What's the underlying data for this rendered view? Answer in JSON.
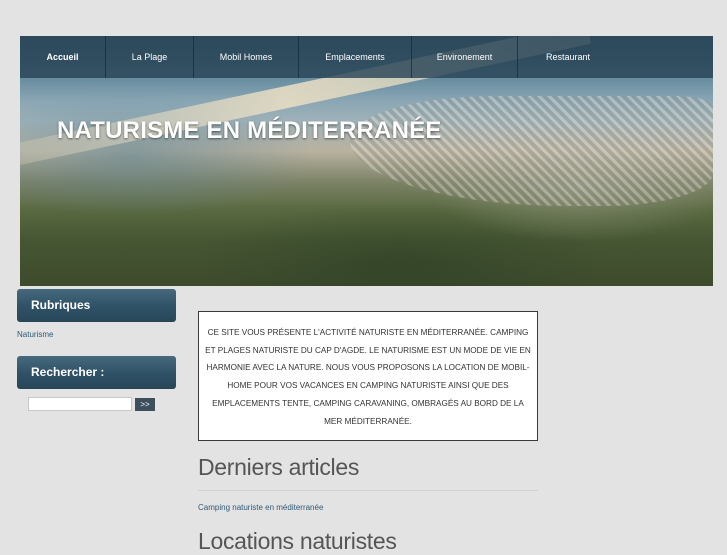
{
  "nav": {
    "items": [
      {
        "label": "Accueil",
        "active": true
      },
      {
        "label": "La Plage",
        "active": false
      },
      {
        "label": "Mobil Homes",
        "active": false
      },
      {
        "label": "Emplacements",
        "active": false
      },
      {
        "label": "Environement",
        "active": false
      },
      {
        "label": "Restaurant",
        "active": false
      }
    ]
  },
  "header": {
    "title": "NATURISME EN MÉDITERRANÉE"
  },
  "sidebar": {
    "rubriques_heading": "Rubriques",
    "rubriques_items": [
      "Naturisme"
    ],
    "search_heading": "Rechercher :",
    "search_value": "",
    "search_button": ">>"
  },
  "main": {
    "intro_text": "CE SITE VOUS PRÉSENTE L'ACTIVITÉ NATURISTE EN MÉDITERRANÉE. CAMPING ET PLAGES NATURISTE DU CAP D'AGDE. LE NATURISME EST UN MODE DE VIE EN HARMONIE AVEC LA NATURE. NOUS VOUS PROPOSONS LA LOCATION DE MOBIL-HOME POUR VOS VACANCES EN CAMPING NATURISTE AINSI QUE DES EMPLACEMENTS TENTE, CAMPING CARAVANING, OMBRAGÉS AU BORD DE LA MER MÉDITERRANÉE.",
    "latest_heading": "Derniers articles",
    "latest_items": [
      "Camping naturiste en méditerranée"
    ],
    "rentals_heading": "Locations naturistes"
  },
  "colors": {
    "nav_bg": "#2a4658",
    "sidebar_heading_bg": "#2f5166",
    "link": "#2e5a78",
    "page_bg": "#e3e3e3"
  }
}
